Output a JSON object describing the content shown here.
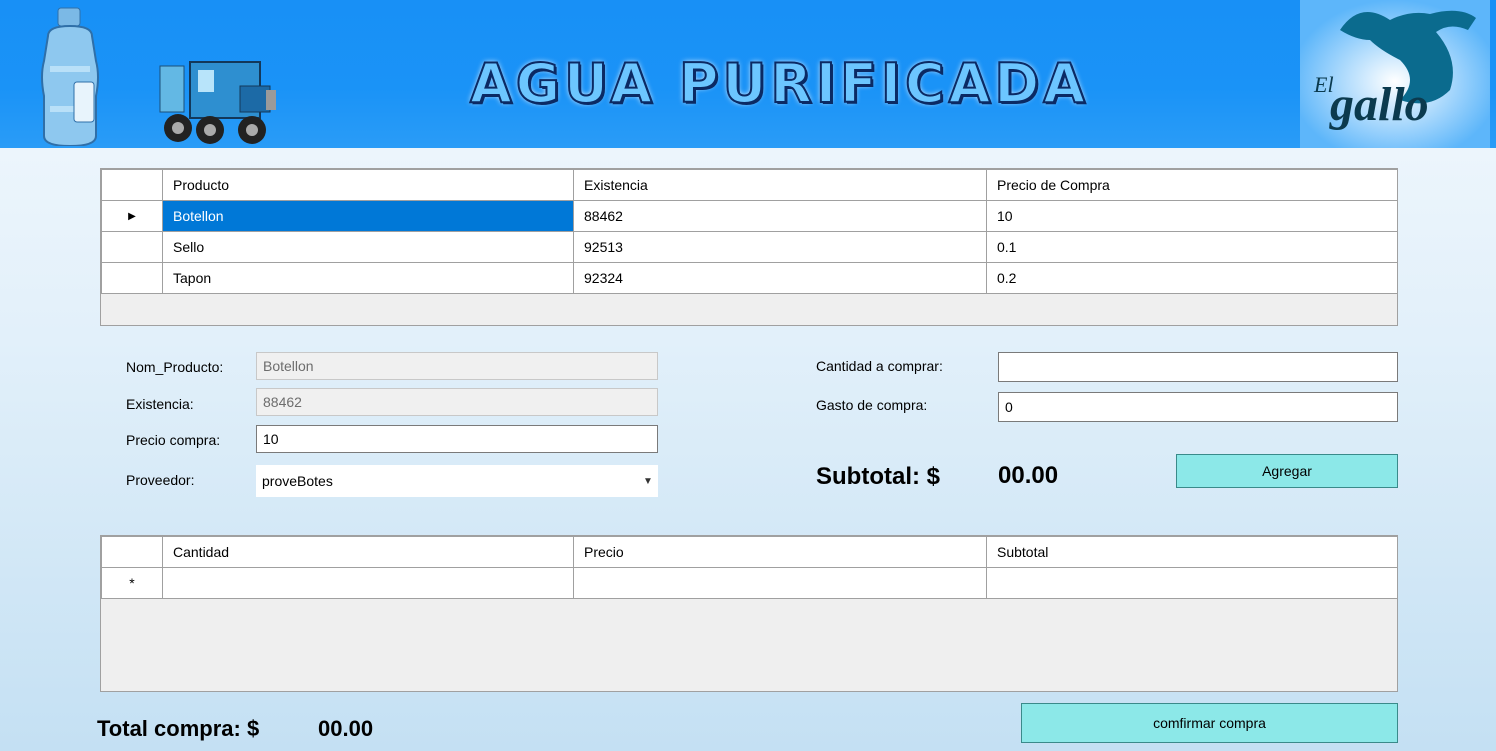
{
  "header": {
    "title": "AGUA PURIFICADA",
    "logo_text_top": "El",
    "logo_text_bottom": "gallo",
    "accent_color": "#1890f6"
  },
  "products_grid": {
    "columns": [
      "Producto",
      "Existencia",
      "Precio de Compra"
    ],
    "rows": [
      {
        "producto": "Botellon",
        "existencia": "88462",
        "precio": "10",
        "selected": true
      },
      {
        "producto": "Sello",
        "existencia": "92513",
        "precio": "0.1",
        "selected": false
      },
      {
        "producto": "Tapon",
        "existencia": "92324",
        "precio": "0.2",
        "selected": false
      }
    ],
    "current_row_indicator": "▶"
  },
  "form": {
    "nom_producto_label": "Nom_Producto:",
    "nom_producto_value": "Botellon",
    "existencia_label": "Existencia:",
    "existencia_value": "88462",
    "precio_label": "Precio compra:",
    "precio_value": "10",
    "proveedor_label": "Proveedor:",
    "proveedor_value": "proveBotes",
    "cantidad_label": "Cantidad a comprar:",
    "cantidad_value": "",
    "gasto_label": "Gasto de compra:",
    "gasto_value": "0",
    "subtotal_label": "Subtotal: $",
    "subtotal_value": "00.00",
    "agregar_label": "Agregar"
  },
  "detail_grid": {
    "columns": [
      "Cantidad",
      "Precio",
      "Subtotal"
    ],
    "new_row_indicator": "*"
  },
  "footer": {
    "total_label": "Total compra: $",
    "total_value": "00.00",
    "confirm_label": "comfirmar compra"
  }
}
